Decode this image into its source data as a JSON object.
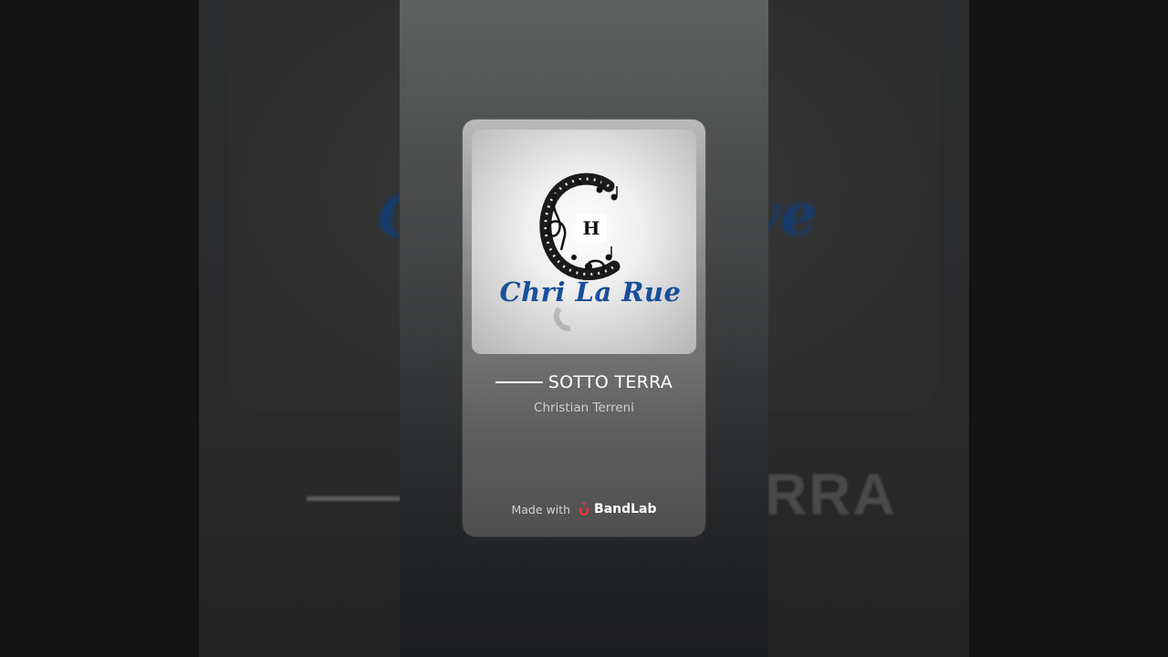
{
  "track": {
    "title": "SOTTO TERRA",
    "artist": "Christian Terreni"
  },
  "cover": {
    "logo_text": "Chri La Rue",
    "badge_letter": "H"
  },
  "footer": {
    "made_with": "Made with",
    "brand_name": "BandLab",
    "brand_icon": "bandlab-logo-icon",
    "brand_color": "#e5343a"
  },
  "background": {
    "left_text": "C",
    "right_text": "ve",
    "title_fragment": "RRA"
  },
  "colors": {
    "logo_blue": "#1a4f9a",
    "title_white": "#ffffff"
  }
}
